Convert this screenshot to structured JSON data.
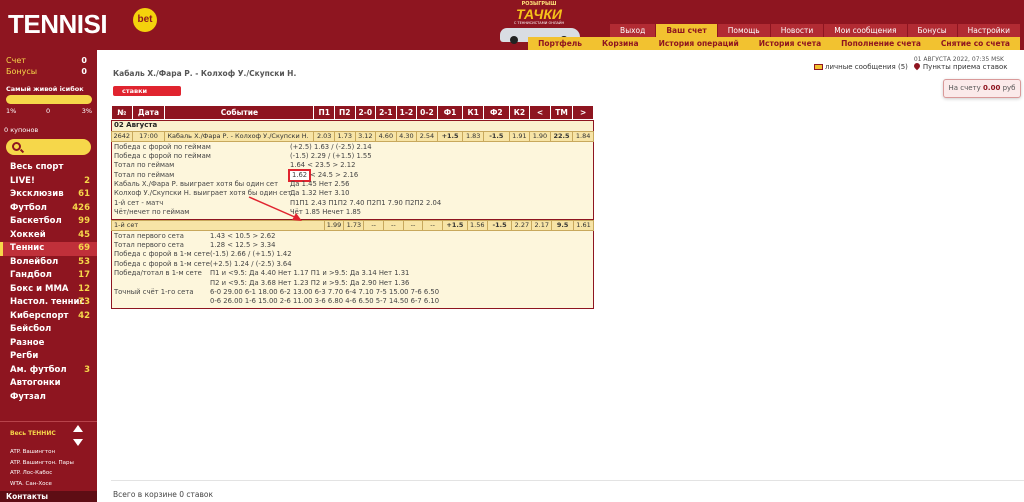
{
  "header": {
    "logo": "TENNISI",
    "logo_badge": "bet",
    "promo_top": "РОЗЫГРЫШ",
    "promo_title": "ТАЧКИ",
    "promo_sub": "С ТЕННИСИСТАМИ ОНЛАЙН",
    "nav": [
      "Выход",
      "Ваш счет",
      "Помощь",
      "Новости",
      "Мои сообщения",
      "Бонусы",
      "Настройки"
    ],
    "nav_active": 1,
    "subnav": [
      "Портфель",
      "Корзина",
      "История операций",
      "История счета",
      "Пополнение счета",
      "Снятие со счета"
    ]
  },
  "sidebar": {
    "account_label": "Счет",
    "account_value": "0",
    "bonus_label": "Бонусы",
    "bonus_value": "0",
    "tennis_survivor": "Самый живой ісибок",
    "scale": [
      "1%",
      "0",
      "3%"
    ],
    "coupons": "0 купонов",
    "search_placeholder": "",
    "sports": [
      {
        "name": "Весь спорт",
        "count": ""
      },
      {
        "name": "LIVE!",
        "count": "2"
      },
      {
        "name": "Эксклюзив",
        "count": "61"
      },
      {
        "name": "Футбол",
        "count": "426"
      },
      {
        "name": "Баскетбол",
        "count": "99"
      },
      {
        "name": "Хоккей",
        "count": "45"
      },
      {
        "name": "Теннис",
        "count": "69"
      },
      {
        "name": "Волейбол",
        "count": "53"
      },
      {
        "name": "Гандбол",
        "count": "17"
      },
      {
        "name": "Бокс и ММА",
        "count": "12"
      },
      {
        "name": "Настол. теннис",
        "count": "73"
      },
      {
        "name": "Киберспорт",
        "count": "42"
      },
      {
        "name": "Бейсбол",
        "count": ""
      },
      {
        "name": "Разное",
        "count": ""
      },
      {
        "name": "Регби",
        "count": ""
      },
      {
        "name": "Ам. футбол",
        "count": "3"
      },
      {
        "name": "Автогонки",
        "count": ""
      },
      {
        "name": "Футзал",
        "count": ""
      }
    ],
    "active_sport": 6,
    "all_tennis": "Весь ТЕННИС",
    "tournaments": [
      "ATP. Вашингтон",
      "ATP. Вашингтон. Пары",
      "ATP. Лос-Кабос",
      "WTA. Сан-Хосе",
      "WTA. Вашингтон"
    ],
    "contacts": "Контакты"
  },
  "main": {
    "match_title": "Кабаль Х./Фара Р. - Колхоф У./Скупски Н.",
    "datetime": "01 АВГУСТА 2022, 07:35 MSK",
    "messages": "личные сообщения (5)",
    "points": "Пункты приема ставок",
    "balance_label": "На счету",
    "balance_value": "0.00",
    "balance_cur": "руб",
    "bets_tab": "ставки",
    "cart": "Всего в корзине 0 ставок"
  },
  "table": {
    "headers": [
      "№",
      "Дата",
      "Событие",
      "П1",
      "П2",
      "2-0",
      "2-1",
      "1-2",
      "0-2",
      "Ф1",
      "К1",
      "Ф2",
      "К2",
      "<",
      "ТМ",
      ">"
    ],
    "day": "02 Августа",
    "event_row": [
      "2642",
      "17:00",
      "Кабаль Х./Фара Р. - Колхоф У./Скупски Н.",
      "2.03",
      "1.73",
      "3.12",
      "4.60",
      "4.30",
      "2.54",
      "+1.5",
      "1.83",
      "-1.5",
      "1.91",
      "1.90",
      "22.5",
      "1.84"
    ],
    "set_row": [
      "1-й сет",
      "1.99",
      "1.73",
      "--",
      "--",
      "--",
      "--",
      "+1.5",
      "1.56",
      "-1.5",
      "2.27",
      "2.17",
      "9.5",
      "1.61"
    ],
    "m1": "Победа с форой по геймам",
    "m1v": "(+2.5) 1.63 / (-2.5) 2.14",
    "m2": "Победа с форой по геймам",
    "m2v": "(-1.5) 2.29 / (+1.5) 1.55",
    "m3": "Тотал по геймам",
    "m3v": "1.64 < 23.5 > 2.12",
    "m4": "Тотал по геймам",
    "m4a": "1.62",
    "m4v": "< 24.5 > 2.16",
    "m5": "Кабаль Х./Фара Р. выиграет хотя бы один сет",
    "m5v": "Да 1.45  Нет 2.56",
    "m6": "Колхоф У./Скупски Н. выиграет хотя бы один сет",
    "m6v": "Да 1.32  Нет 3.10",
    "m7": "1-й сет - матч",
    "m7v": "П1П1 2.43  П1П2 7.40  П2П1 7.90  П2П2 2.04",
    "m8": "Чёт/нечет по геймам",
    "m8v": "Чёт 1.85  Нечет 1.85",
    "s1": "Тотал первого сета",
    "s1v": "1.43 < 10.5 > 2.62",
    "s2": "Тотал первого сета",
    "s2v": "1.28 < 12.5 > 3.34",
    "s3": "Победа с форой в 1-м сете",
    "s3v": "(-1.5) 2.66 / (+1.5) 1.42",
    "s4": "Победа с форой в 1-м сете",
    "s4v": "(+2.5) 1.24 / (-2.5) 3.64",
    "s5": "Победа/тотал в 1-м сете",
    "s5v": "П1 и <9.5: Да 4.40 Нет 1.17    П1 и >9.5: Да 3.14 Нет 1.31",
    "s6v": "П2 и <9.5: Да 3.68 Нет 1.23    П2 и >9.5: Да 2.90 Нет 1.36",
    "s7": "Точный счёт 1-го сета",
    "s7v": "6-0 29.00  6-1 18.00  6-2 13.00  6-3 7.70  6-4 7.10  7-5 15.00  7-6 6.50",
    "s8v": "0-6 26.00  1-6 15.00  2-6 11.00  3-6 6.80  4-6 6.50  5-7 14.50  6-7 6.10"
  },
  "colors": {
    "brand": "#8e1520",
    "accent": "#f2c230",
    "highlight": "#e0242f"
  }
}
